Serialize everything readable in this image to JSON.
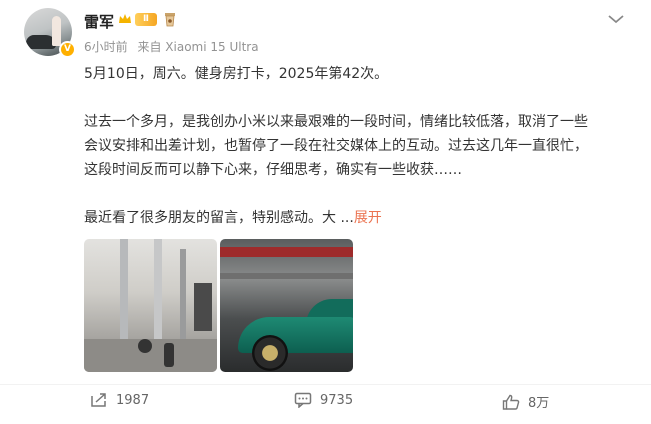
{
  "user": {
    "name": "雷军",
    "level_badge": "Ⅱ",
    "verified_mark": "V"
  },
  "meta": {
    "time": "6小时前",
    "source": "来自 Xiaomi 15 Ultra"
  },
  "post": {
    "line1": "5月10日，周六。健身房打卡，2025年第42次。",
    "line2": "过去一个多月，是我创办小米以来最艰难的一段时间，情绪比较低落，取消了一些",
    "line3": "会议安排和出差计划，也暂停了一段在社交媒体上的互动。过去这几年一直很忙，",
    "line4": "这段时间反而可以静下心来，仔细思考，确实有一些收获……",
    "line5": "最近看了很多朋友的留言，特别感动。大 ...",
    "expand_label": "展开"
  },
  "actions": {
    "repost_count": "1987",
    "comment_count": "9735",
    "like_count": "8万"
  },
  "icons": {
    "more": "more-icon",
    "repost": "repost-icon",
    "comment": "comment-icon",
    "like": "like-icon"
  },
  "colors": {
    "expand_link": "#eb7350",
    "meta_text": "#939393",
    "level_badge": "#f5a623"
  }
}
